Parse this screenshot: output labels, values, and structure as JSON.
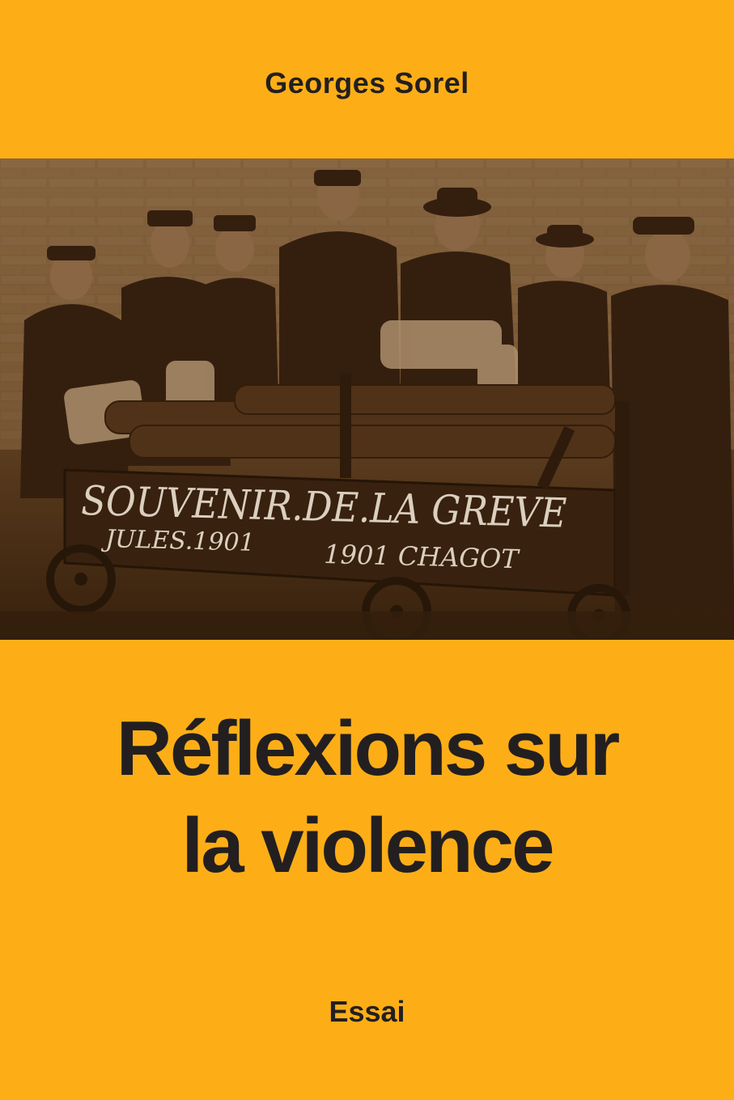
{
  "cover": {
    "author": "Georges Sorel",
    "title_line1": "Réflexions sur",
    "title_line2": "la violence",
    "subtitle": "Essai",
    "background_color": "#FDAE17",
    "text_color": "#231F20"
  },
  "photo": {
    "sign_line1": "SOUVENIR.DE.LA GREVE",
    "sign_line2_left": "JULES.1901",
    "sign_line2_right": "1901 CHAGOT"
  }
}
